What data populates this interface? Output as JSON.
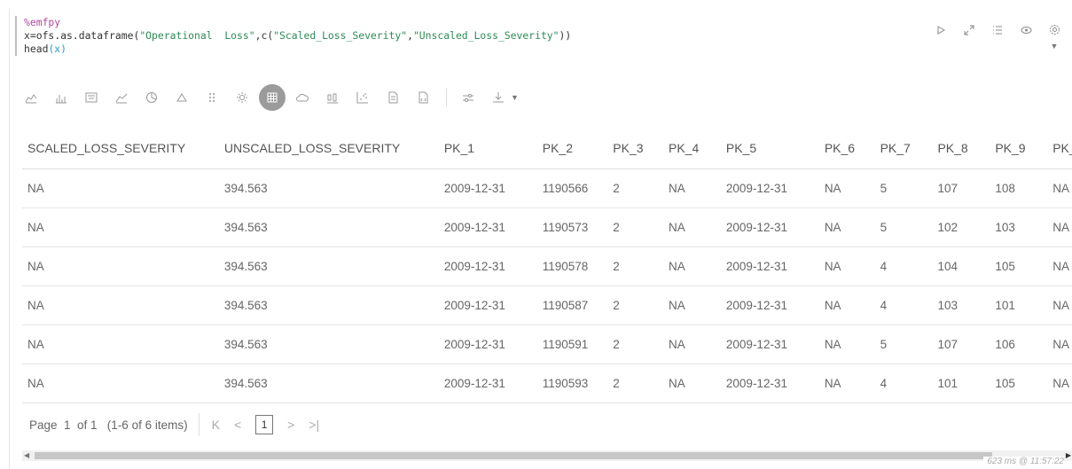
{
  "editor": {
    "lines": [
      {
        "parts": [
          {
            "t": "%emfpy",
            "c": "k-magic"
          }
        ]
      },
      {
        "parts": [
          {
            "t": "x=ofs.as.dataframe(",
            "c": "k-plain"
          },
          {
            "t": "\"Operational  Loss\"",
            "c": "k-str"
          },
          {
            "t": ",c(",
            "c": "k-plain"
          },
          {
            "t": "\"Scaled_Loss_Severity\"",
            "c": "k-str"
          },
          {
            "t": ",",
            "c": "k-plain"
          },
          {
            "t": "\"Unscaled_Loss_Severity\"",
            "c": "k-str"
          },
          {
            "t": "))",
            "c": "k-plain"
          }
        ]
      },
      {
        "parts": [
          {
            "t": "head",
            "c": "k-plain"
          },
          {
            "t": "(x)",
            "c": "k-paren"
          }
        ]
      }
    ]
  },
  "paragraph_controls": [
    "run-icon",
    "expand-icon",
    "list-numbers-icon",
    "eye-icon",
    "gear-icon"
  ],
  "toolbar": {
    "icons": [
      "line-chart-icon",
      "bar-chart-icon",
      "funnel-chart-icon",
      "area-chart-icon",
      "pie-chart-icon",
      "triangle-chart-icon",
      "scatter-dots-icon",
      "sun-burst-icon",
      "table-icon",
      "cloud-icon",
      "box-plot-icon",
      "scatter-chart-icon",
      "document-icon",
      "code-file-icon"
    ],
    "active": "table-icon",
    "extra": [
      "settings-sliders-icon",
      "download-icon"
    ]
  },
  "table": {
    "columns": [
      "SCALED_LOSS_SEVERITY",
      "UNSCALED_LOSS_SEVERITY",
      "PK_1",
      "PK_2",
      "PK_3",
      "PK_4",
      "PK_5",
      "PK_6",
      "PK_7",
      "PK_8",
      "PK_9",
      "PK_"
    ],
    "rows": [
      [
        "NA",
        "394.563",
        "2009-12-31",
        "1190566",
        "2",
        "NA",
        "2009-12-31",
        "NA",
        "5",
        "107",
        "108",
        "NA"
      ],
      [
        "NA",
        "394.563",
        "2009-12-31",
        "1190573",
        "2",
        "NA",
        "2009-12-31",
        "NA",
        "5",
        "102",
        "103",
        "NA"
      ],
      [
        "NA",
        "394.563",
        "2009-12-31",
        "1190578",
        "2",
        "NA",
        "2009-12-31",
        "NA",
        "4",
        "104",
        "105",
        "NA"
      ],
      [
        "NA",
        "394.563",
        "2009-12-31",
        "1190587",
        "2",
        "NA",
        "2009-12-31",
        "NA",
        "4",
        "103",
        "101",
        "NA"
      ],
      [
        "NA",
        "394.563",
        "2009-12-31",
        "1190591",
        "2",
        "NA",
        "2009-12-31",
        "NA",
        "5",
        "107",
        "106",
        "NA"
      ],
      [
        "NA",
        "394.563",
        "2009-12-31",
        "1190593",
        "2",
        "NA",
        "2009-12-31",
        "NA",
        "4",
        "101",
        "105",
        "NA"
      ]
    ]
  },
  "pager": {
    "summary": "Page  1  of 1   (1-6 of 6 items)",
    "current_page": "1"
  },
  "status": {
    "timing": "623 ms @ 11:57:22"
  }
}
